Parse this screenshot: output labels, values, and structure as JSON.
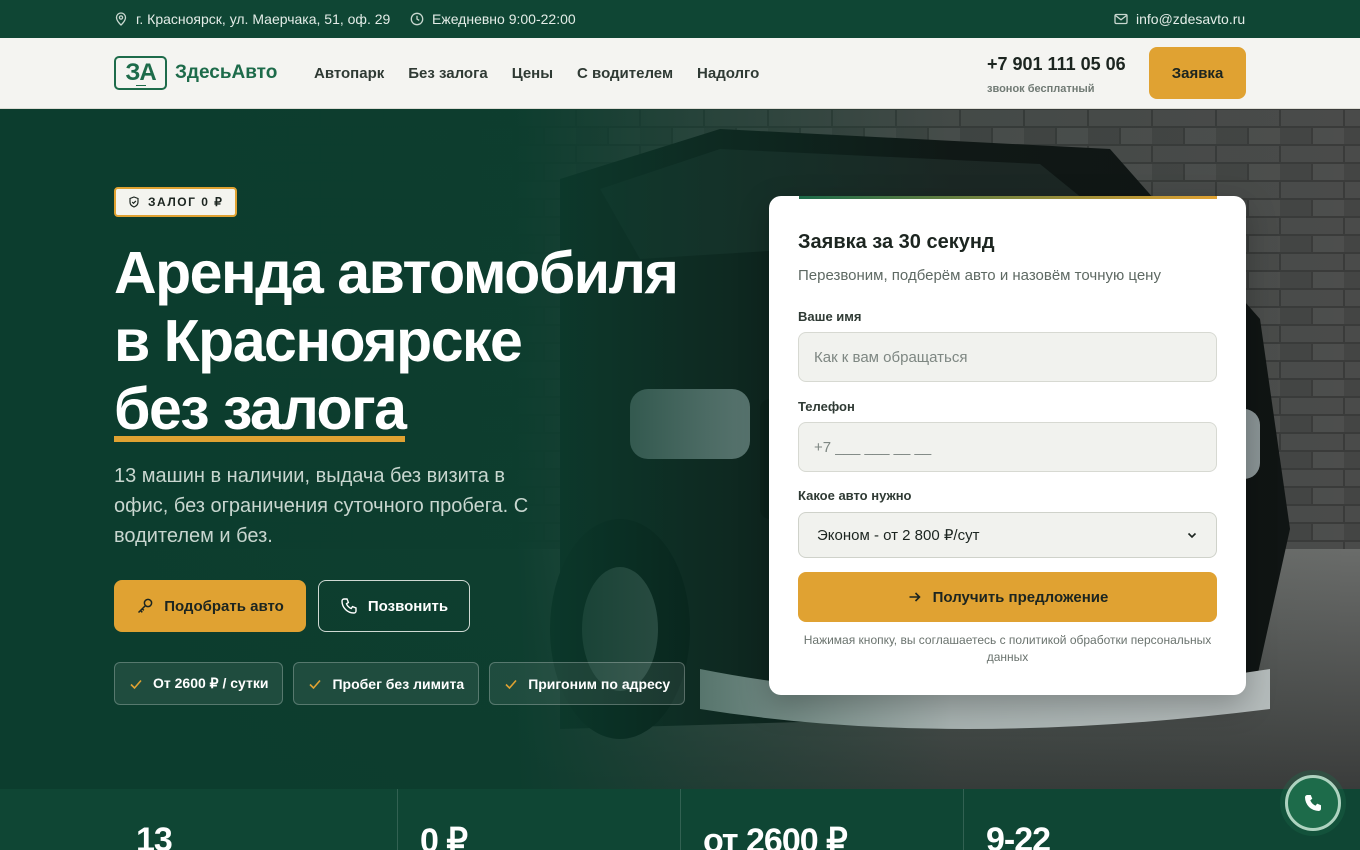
{
  "topbar": {
    "address": "г. Красноярск, ул. Маерчака, 51, оф. 29",
    "hours": "Ежедневно 9:00-22:00",
    "email": "info@zdesavto.ru"
  },
  "header": {
    "logo_mark": "ЗА",
    "logo_text": "ЗдесьАвто",
    "nav": [
      "Автопарк",
      "Без залога",
      "Цены",
      "С водителем",
      "Надолго"
    ],
    "phone": "+7 901 111 05 06",
    "phone_note": "звонок бесплатный",
    "order_button": "Заявка"
  },
  "hero": {
    "badge": "ЗАЛОГ 0 ₽",
    "title_line1": "Аренда автомобиля",
    "title_line2": "в Красноярске",
    "title_accent": "без залога",
    "subtitle": "13 машин в наличии, выдача без визита в офис, без ограничения суточного пробега. С водителем и без.",
    "pick_button": "Подобрать авто",
    "call_button": "Позвонить",
    "chips": [
      "От 2600 ₽ / сутки",
      "Пробег без лимита",
      "Пригоним по адресу"
    ]
  },
  "form": {
    "title": "Заявка за 30 секунд",
    "subtitle": "Перезвоним, подберём авто и назовём точную цену",
    "name_label": "Ваше имя",
    "name_placeholder": "Как к вам обращаться",
    "phone_label": "Телефон",
    "phone_placeholder": "+7 ___ ___ __ __",
    "car_label": "Какое авто нужно",
    "car_selected": "Эконом - от 2 800 ₽/сут",
    "submit": "Получить предложение",
    "note": "Нажимая кнопку, вы соглашаетесь с политикой обработки персональных данных"
  },
  "stats": [
    "13",
    "0 ₽",
    "от 2600 ₽",
    "9-22"
  ],
  "colors": {
    "brand_green": "#0f4634",
    "accent_gold": "#e0a232",
    "logo_green": "#1d6b4a"
  }
}
